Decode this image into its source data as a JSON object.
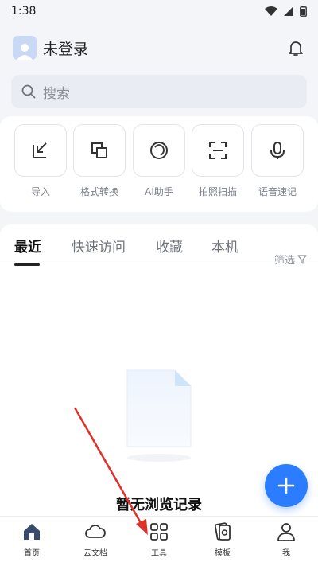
{
  "status_bar": {
    "time": "1:38"
  },
  "header": {
    "user_name": "未登录"
  },
  "search": {
    "placeholder": "搜索"
  },
  "tools": [
    {
      "label": "导入",
      "icon": "import-icon"
    },
    {
      "label": "格式转换",
      "icon": "format-convert-icon"
    },
    {
      "label": "AI助手",
      "icon": "ai-assistant-icon"
    },
    {
      "label": "拍照扫描",
      "icon": "scan-icon"
    },
    {
      "label": "语音速记",
      "icon": "microphone-icon"
    }
  ],
  "tabs": [
    {
      "label": "最近",
      "active": true
    },
    {
      "label": "快速访问"
    },
    {
      "label": "收藏"
    },
    {
      "label": "本机"
    }
  ],
  "filter_label": "筛选",
  "empty_state": {
    "text": "暂无浏览记录"
  },
  "bottom_nav": [
    {
      "label": "首页",
      "icon": "home-icon",
      "active": true
    },
    {
      "label": "云文档",
      "icon": "cloud-icon"
    },
    {
      "label": "工具",
      "icon": "grid-icon"
    },
    {
      "label": "模板",
      "icon": "template-icon"
    },
    {
      "label": "我",
      "icon": "user-icon"
    }
  ],
  "colors": {
    "accent": "#2b7cff",
    "annotation_arrow": "#e0302a"
  }
}
